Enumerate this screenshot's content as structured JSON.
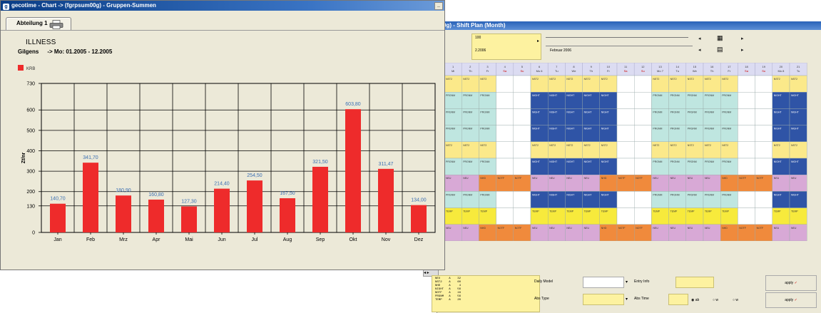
{
  "chart_window": {
    "title": "gecotime - Chart -> (fgrpsum00g) - Gruppen-Summen",
    "tab_label": "Abteilung 1",
    "chart_title": "ILLNESS",
    "subtitle_name": "Gilgens",
    "subtitle_range": "-> Mo: 01.2005 - 12.2005"
  },
  "chart_data": {
    "type": "bar",
    "title": "ILLNESS",
    "ylabel": "Zt/nr",
    "xlabel": "",
    "categories": [
      "Jan",
      "Feb",
      "Mrz",
      "Apr",
      "Mai",
      "Jun",
      "Jul",
      "Aug",
      "Sep",
      "Okt",
      "Nov",
      "Dez"
    ],
    "series": [
      {
        "name": "KRB",
        "values": [
          140.7,
          341.7,
          180.9,
          160.8,
          127.3,
          214.4,
          254.5,
          167.5,
          321.5,
          603.8,
          311.47,
          134.0
        ]
      }
    ],
    "value_labels": [
      "140,70",
      "341,70",
      "180,90",
      "160,80",
      "127,30",
      "214,40",
      "254,50",
      "167,50",
      "321,50",
      "603,80",
      "311,47",
      "134,00"
    ],
    "yticks": [
      0,
      130,
      200,
      300,
      400,
      500,
      600,
      730
    ],
    "ylim": [
      0,
      730
    ],
    "grid": true,
    "legend_position": "top-left",
    "bar_color": "#ee2b2b",
    "label_color": "#3a6fb3"
  },
  "plan_window": {
    "title": "0g) - Shift Plan (Month)",
    "box_line1": "100",
    "box_line2": "2.2006",
    "month_label": "Februar 2006",
    "day_headers": [
      {
        "d": "1",
        "w": "Mi"
      },
      {
        "d": "2",
        "w": "Th"
      },
      {
        "d": "3",
        "w": "Fr"
      },
      {
        "d": "4",
        "w": "Sa"
      },
      {
        "d": "5",
        "w": "Su"
      },
      {
        "d": "6",
        "w": "Mo 6"
      },
      {
        "d": "7",
        "w": "Tu"
      },
      {
        "d": "8",
        "w": "We"
      },
      {
        "d": "9",
        "w": "Th"
      },
      {
        "d": "10",
        "w": "Fr"
      },
      {
        "d": "11",
        "w": "Sa"
      },
      {
        "d": "12",
        "w": "Su"
      },
      {
        "d": "13",
        "w": "Mo 7"
      },
      {
        "d": "14",
        "w": "Tu"
      },
      {
        "d": "15",
        "w": "We"
      },
      {
        "d": "16",
        "w": "Th"
      },
      {
        "d": "17",
        "w": "Fr"
      },
      {
        "d": "18",
        "w": "Sa"
      },
      {
        "d": "19",
        "w": "Su"
      },
      {
        "d": "20",
        "w": "Mo 8"
      },
      {
        "d": "21",
        "w": "Tu"
      }
    ],
    "row_labels": [
      "ohnes",
      "n",
      "hu",
      "n",
      "ohen",
      "idt",
      "ann",
      "",
      "ella",
      "zel"
    ],
    "rows": [
      "NST2 NST2 NST2 - - NST2 NST2 NST2 NST2 NST2 - - NST2 NST2 NST2 NST2 NST2 - - NST2 NST2",
      "PRGNM PRGNM PRGNM - - NIGHT NIGHT NIGHT NIGHT NIGHT - - PRGNM PRGNM PRGNM PRGNM PRGNM - - NIGHT NIGHT",
      "PRGNM PRGNM PRGNM - - NIGHT NIGHT NIGHT NIGHT NIGHT - - PRGNM PRGNM PRGNM PRGNM PRGNM - - NIGHT NIGHT",
      "PRGNM PRGNM PRGNM - - NIGHT NIGHT NIGHT NIGHT NIGHT - - PRGNM PRGNM PRGNM PRGNM PRGNM - - NIGHT NIGHT",
      "NST2 NST2 NST2 - - NST2 NST2 NST2 NST2 NST2 - - NST2 NST2 NST2 NST2 NST2 - - NST2 NST2",
      "PRGNM PRGNM PRGNM - - NIGHT NIGHT NIGHT NIGHT NIGHT - - PRGNM PRGNM PRGNM PRGNM PRGNM - - NIGHT NIGHT",
      "NEU NEU NHD NOTF NOTF NEU NEU NEU NEU NHD NOTF NOTF NEU NEU NEU NEU NHD NOTF NOTF NEU NEU",
      "PRGNM PRGNM PRGNM - - NIGHT NIGHT NIGHT NIGHT NIGHT - - PRGNM PRGNM PRGNM PRGNM PRGNM - - NIGHT NIGHT",
      "TEMP TEMP TEMP - - TEMP TEMP TEMP TEMP TEMP - - TEMP TEMP TEMP TEMP TEMP - - TEMP TEMP",
      "NEU NEU NHD NOTF NOTF NEU NEU NEU NEU NHD NOTF NOTF NEU NEU NEU NEU NHD NOTF NOTF NEU NEU"
    ],
    "shift_colors": {
      "NST2": "#fbe98a",
      "PRGNM": "#bfe6e0",
      "NIGHT": "#2f54a6",
      "NEU": "#d8a9d6",
      "NHD": "#f08a3c",
      "NOTF": "#f08a3c",
      "TEMP": "#f7ea3c",
      "-": "#ffffff"
    },
    "legend_text": "NEU     A    32\nNST2    A    60\nNHD     A     4\nNIGHT   A    56\nNOTF    A    16\nPRGNM   A    56\nTEMP    A    20",
    "daily_model_label": "Daily Model",
    "entry_info_label": "Entry Info",
    "abs_type_label": "Abs Type",
    "abs_time_label": "Abs Time",
    "radio1": "ab",
    "radio2": "w",
    "radio3": "w",
    "btn1": "apply",
    "btn2": "apply"
  }
}
